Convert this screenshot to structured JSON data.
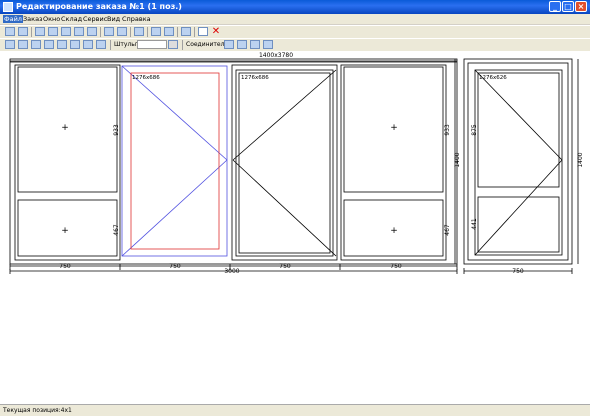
{
  "window": {
    "title": "Редактирование заказа №1 (1 поз.)"
  },
  "menu": [
    "Файл",
    "Заказ",
    "Окно",
    "Склад",
    "Сервис",
    "Вид",
    "Справка"
  ],
  "toolbar2": {
    "shtulp_label": "Штульп:",
    "connector_label": "Соединитель:"
  },
  "drawing": {
    "overall_size": "1400x3780",
    "cells": [
      {
        "width_dim": "750",
        "top_height": "933",
        "bottom_height": "467"
      },
      {
        "width_dim": "750",
        "sash_size": "1276x686"
      },
      {
        "width_dim": "750",
        "sash_size": "1276x686"
      },
      {
        "width_dim": "750",
        "top_height": "933",
        "bottom_height": "467"
      }
    ],
    "total_width": "3000",
    "left_height": "1400",
    "door": {
      "sash_size": "1276x626",
      "top_height": "875",
      "bottom_height": "441",
      "height": "1400",
      "width_dim": "750"
    }
  },
  "status": {
    "position_text": "Текущая позиция:4x1"
  }
}
